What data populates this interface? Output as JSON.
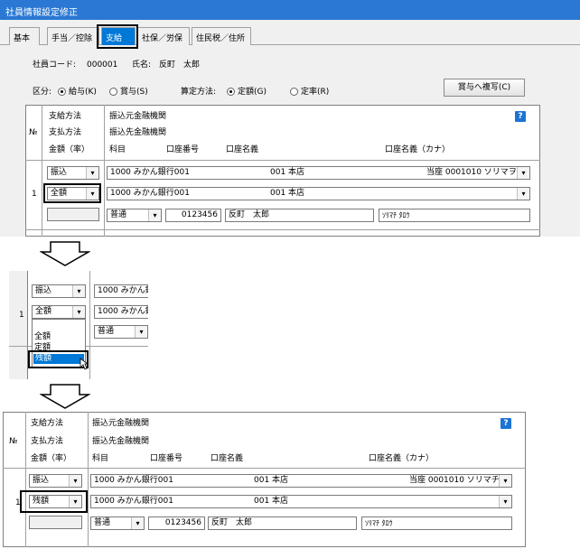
{
  "window": {
    "title": "社員情報設定修正",
    "tabs": [
      "基本",
      "手当／控除",
      "支給",
      "社保／労保",
      "住民税／住所"
    ],
    "selected_tab": "支給"
  },
  "employee": {
    "code_label": "社員コード:",
    "code": "000001",
    "name_label": "氏名:",
    "name": "反町　太郎"
  },
  "options": {
    "category_label": "区分:",
    "category_options": [
      "給与(K)",
      "賞与(S)"
    ],
    "category_selected": "給与(K)",
    "calc_label": "算定方法:",
    "calc_options": [
      "定額(G)",
      "定率(R)"
    ],
    "calc_selected": "定額(G)",
    "copy_button": "賞与へ複写(C)"
  },
  "grid_header": {
    "no": "№",
    "method_lines": [
      "支給方法",
      "支払方法",
      "金額（率）"
    ],
    "bank_lines": [
      "振込元金融機関",
      "振込先金融機関"
    ],
    "bottom_cols": [
      "科目",
      "口座番号",
      "口座名義",
      "口座名義（カナ）"
    ],
    "help": "?"
  },
  "row1": {
    "no": "1",
    "payment_method": "振込",
    "amount_type": "全額",
    "source_bank": "1000 みかん銀行001",
    "source_branch": "001 本店",
    "source_account": "当座 0001010 ソリマヲ",
    "dest_bank": "1000 みかん銀行001",
    "dest_branch": "001 本店",
    "account_type": "普通",
    "account_no": "0123456",
    "holder": "反町　太郎",
    "holder_kana": "ｿﾘﾏﾁ ﾀﾛｳ"
  },
  "step2": {
    "no": "1",
    "payment_method": "振込",
    "amount_type": "全額",
    "bank_partial": "1000 みかん銀",
    "account_type": "普通",
    "dropdown_options": [
      "全額",
      "定額",
      "残額"
    ],
    "dropdown_selected": "残額"
  },
  "step3": {
    "amount_type": "残額",
    "source_account": "当座 0001010 ソリマチ"
  },
  "icons": {
    "dropdown": "▾",
    "arrow_shape": "down-arrow-outline"
  }
}
